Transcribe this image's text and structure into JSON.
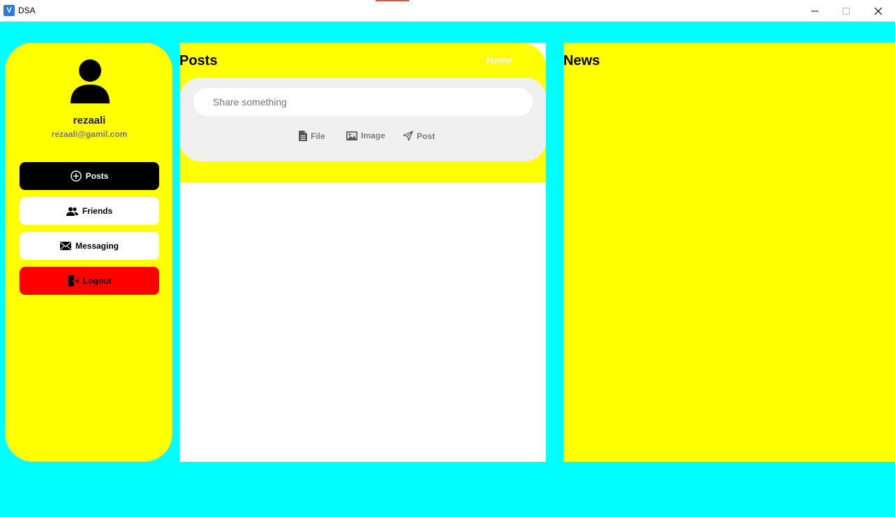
{
  "window": {
    "title": "DSA",
    "app_icon_letter": "V"
  },
  "sidebar": {
    "user": {
      "name": "rezaali",
      "email": "rezaali@gamil.com"
    },
    "nav": {
      "posts": "Posts",
      "friends": "Friends",
      "messaging": "Messaging",
      "logout": "Logout"
    }
  },
  "posts": {
    "title": "Posts",
    "home_link": "Home",
    "composer": {
      "placeholder": "Share something",
      "file": "File",
      "image": "Image",
      "post": "Post"
    }
  },
  "news": {
    "title": "News"
  },
  "colors": {
    "background": "#00ffff",
    "panel": "#ffff00",
    "active_nav": "#000000",
    "logout": "#ff0000"
  }
}
